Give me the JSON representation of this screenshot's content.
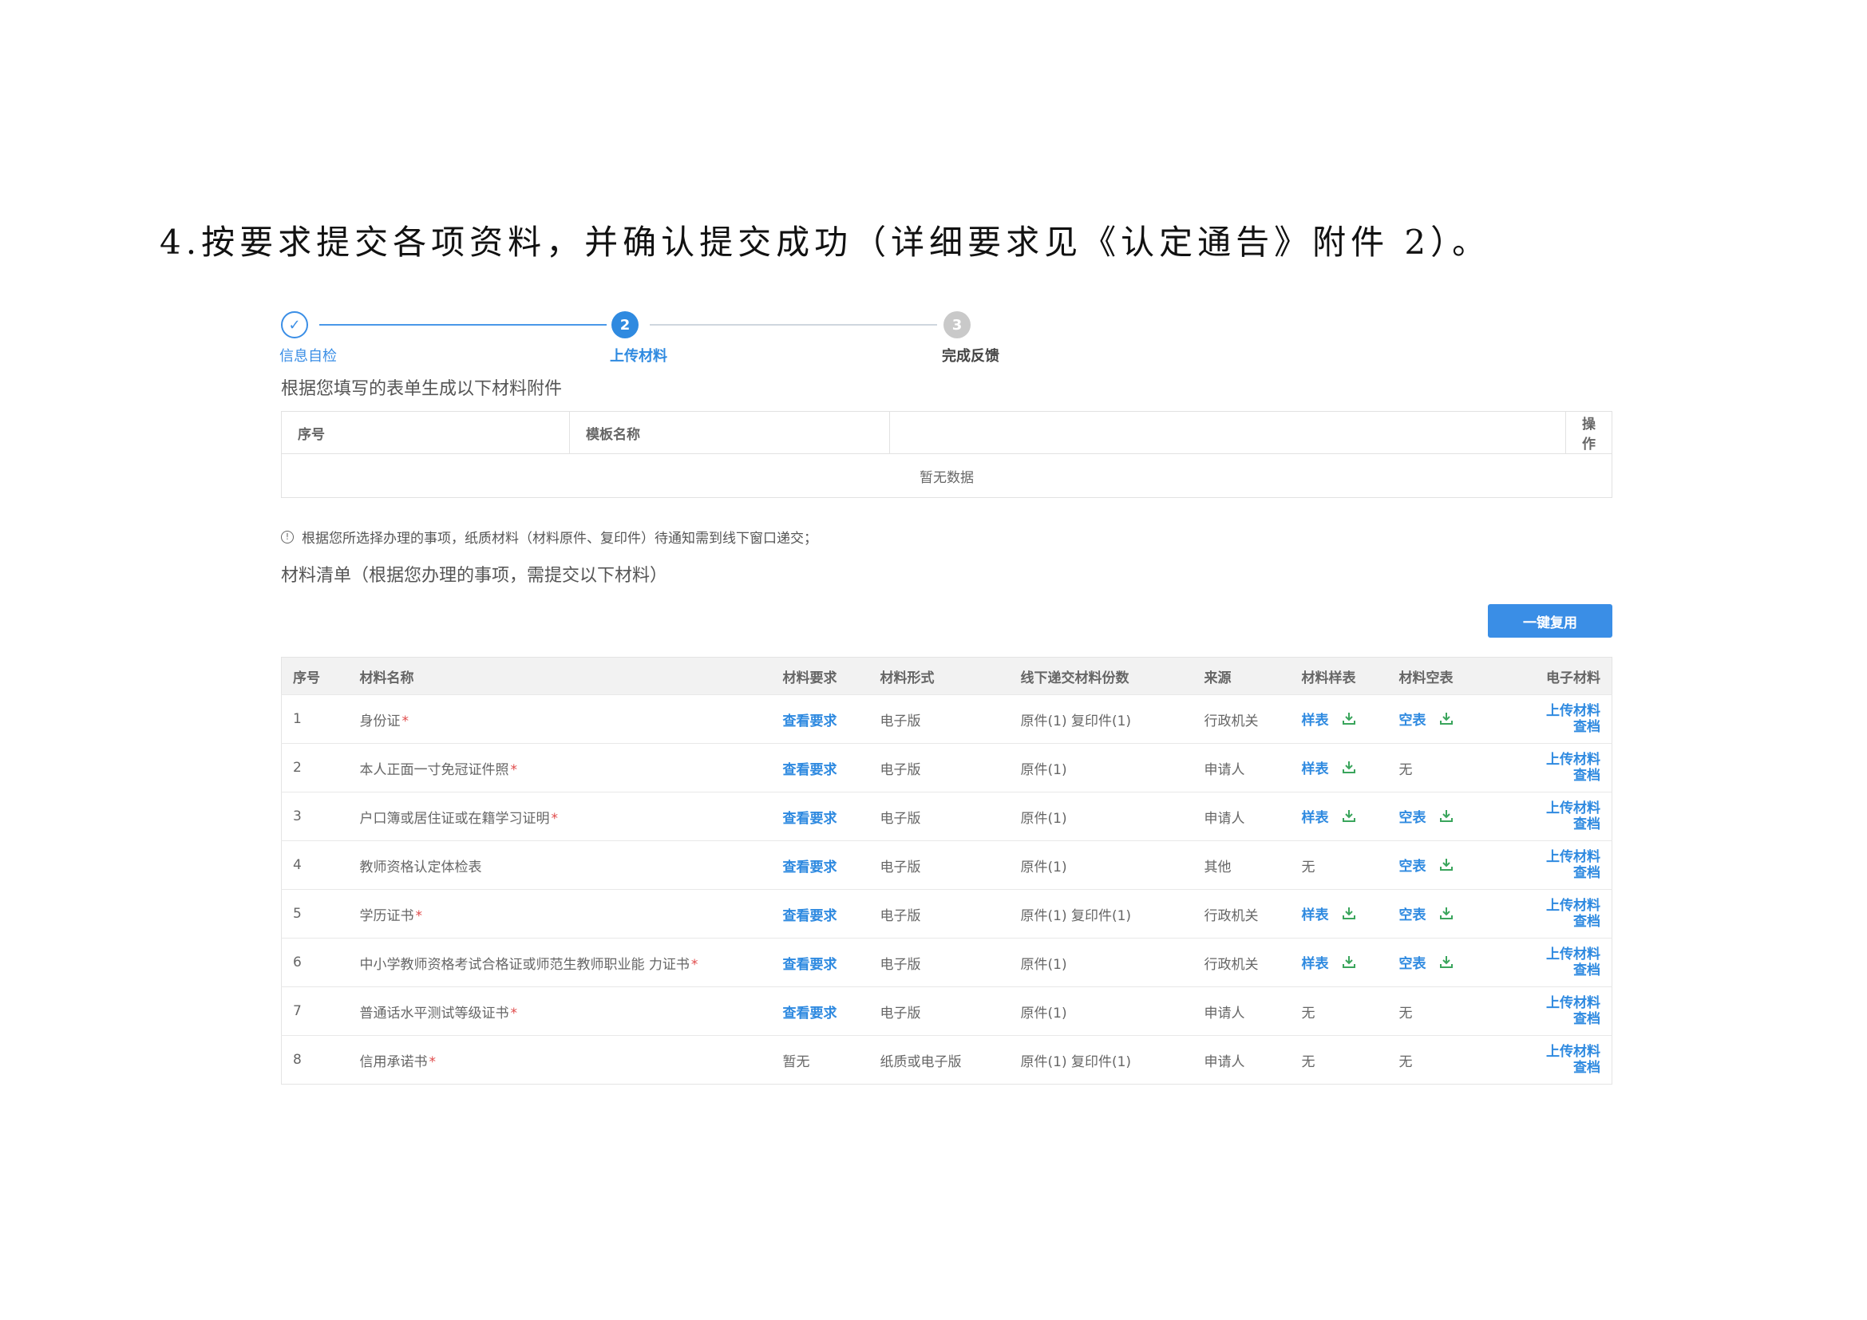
{
  "heading": "4.按要求提交各项资料，并确认提交成功（详细要求见《认定通告》附件 2）。",
  "steps": [
    {
      "num": "✓",
      "label": "信息自检"
    },
    {
      "num": "2",
      "label": "上传材料"
    },
    {
      "num": "3",
      "label": "完成反馈"
    }
  ],
  "template_section": {
    "title": "根据您填写的表单生成以下材料附件",
    "headers": [
      "序号",
      "模板名称",
      "",
      "操作"
    ],
    "empty_text": "暂无数据"
  },
  "notice": "根据您所选择办理的事项，纸质材料（材料原件、复印件）待通知需到线下窗口递交；",
  "materials_section": {
    "title": "材料清单（根据您办理的事项，需提交以下材料）",
    "button": "一键复用",
    "headers": [
      "序号",
      "材料名称",
      "材料要求",
      "材料形式",
      "线下递交材料份数",
      "来源",
      "材料样表",
      "材料空表",
      "电子材料"
    ],
    "op_upload": "上传材料",
    "op_view": "查档",
    "rows": [
      {
        "no": "1",
        "name": "身份证",
        "req": "*",
        "requirement": "查看要求",
        "form": "电子版",
        "copies": "原件(1) 复印件(1)",
        "source": "行政机关",
        "sample": "样表",
        "blank": "空表"
      },
      {
        "no": "2",
        "name": "本人正面一寸免冠证件照",
        "req": "*",
        "requirement": "查看要求",
        "form": "电子版",
        "copies": "原件(1)",
        "source": "申请人",
        "sample": "样表",
        "blank": "无"
      },
      {
        "no": "3",
        "name": "户口簿或居住证或在籍学习证明",
        "req": "*",
        "requirement": "查看要求",
        "form": "电子版",
        "copies": "原件(1)",
        "source": "申请人",
        "sample": "样表",
        "blank": "空表"
      },
      {
        "no": "4",
        "name": "教师资格认定体检表",
        "req": "",
        "requirement": "查看要求",
        "form": "电子版",
        "copies": "原件(1)",
        "source": "其他",
        "sample": "无",
        "blank": "空表"
      },
      {
        "no": "5",
        "name": "学历证书",
        "req": "*",
        "requirement": "查看要求",
        "form": "电子版",
        "copies": "原件(1) 复印件(1)",
        "source": "行政机关",
        "sample": "样表",
        "blank": "空表"
      },
      {
        "no": "6",
        "name": "中小学教师资格考试合格证或师范生教师职业能 力证书",
        "req": "*",
        "requirement": "查看要求",
        "form": "电子版",
        "copies": "原件(1)",
        "source": "行政机关",
        "sample": "样表",
        "blank": "空表"
      },
      {
        "no": "7",
        "name": "普通话水平测试等级证书",
        "req": "*",
        "requirement": "查看要求",
        "form": "电子版",
        "copies": "原件(1)",
        "source": "申请人",
        "sample": "无",
        "blank": "无"
      },
      {
        "no": "8",
        "name": "信用承诺书",
        "req": "*",
        "requirement": "暂无",
        "form": "纸质或电子版",
        "copies": "原件(1) 复印件(1)",
        "source": "申请人",
        "sample": "无",
        "blank": "无"
      }
    ]
  },
  "colors": {
    "accent": "#2f8ae0",
    "required": "#e04a4a",
    "download": "#3aa55c"
  }
}
